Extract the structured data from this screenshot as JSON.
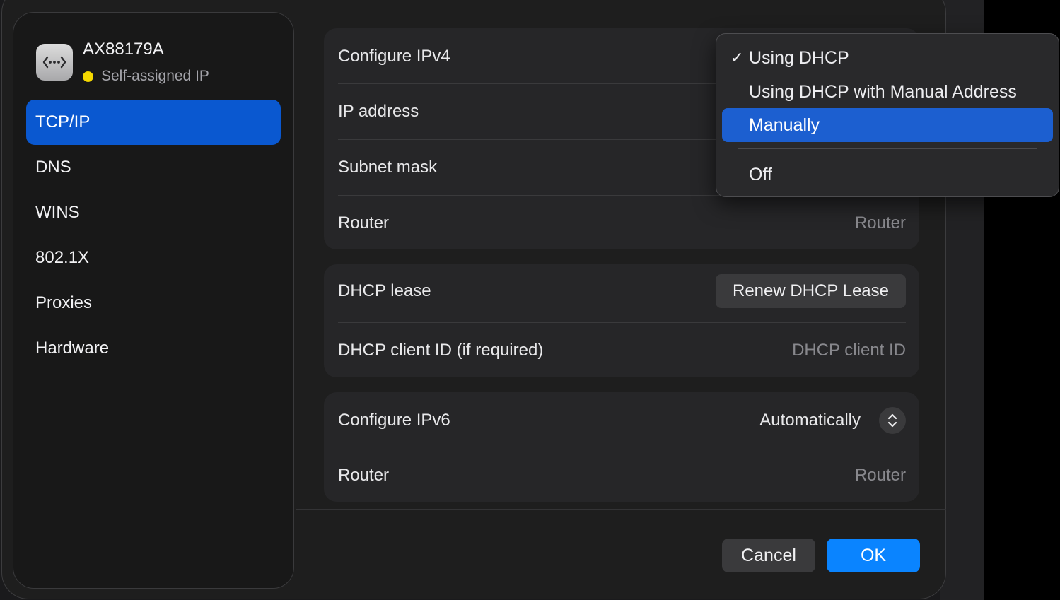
{
  "interface": {
    "name": "AX88179A",
    "status": "Self-assigned IP",
    "status_color": "#f5d800",
    "icon": "ethernet-arrows-icon"
  },
  "sidebar": {
    "items": [
      {
        "label": "TCP/IP",
        "selected": true
      },
      {
        "label": "DNS"
      },
      {
        "label": "WINS"
      },
      {
        "label": "802.1X"
      },
      {
        "label": "Proxies"
      },
      {
        "label": "Hardware"
      }
    ]
  },
  "ipv4": {
    "configure_label": "Configure IPv4",
    "ip_label": "IP address",
    "subnet_label": "Subnet mask",
    "router_label": "Router",
    "router_placeholder": "Router"
  },
  "dhcp": {
    "lease_label": "DHCP lease",
    "renew_button": "Renew DHCP Lease",
    "client_id_label": "DHCP client ID (if required)",
    "client_id_placeholder": "DHCP client ID"
  },
  "ipv6": {
    "configure_label": "Configure IPv6",
    "configure_value": "Automatically",
    "router_label": "Router",
    "router_placeholder": "Router"
  },
  "buttons": {
    "cancel": "Cancel",
    "ok": "OK"
  },
  "dropdown": {
    "check": "✓",
    "options": [
      {
        "label": "Using DHCP",
        "checked": true
      },
      {
        "label": "Using DHCP with Manual Address"
      },
      {
        "label": "Manually",
        "highlighted": true
      },
      {
        "label": "Off"
      }
    ]
  },
  "colors": {
    "accent": "#0a84ff",
    "selection": "#0a58d0",
    "menu_highlight": "#1c5fd0"
  }
}
